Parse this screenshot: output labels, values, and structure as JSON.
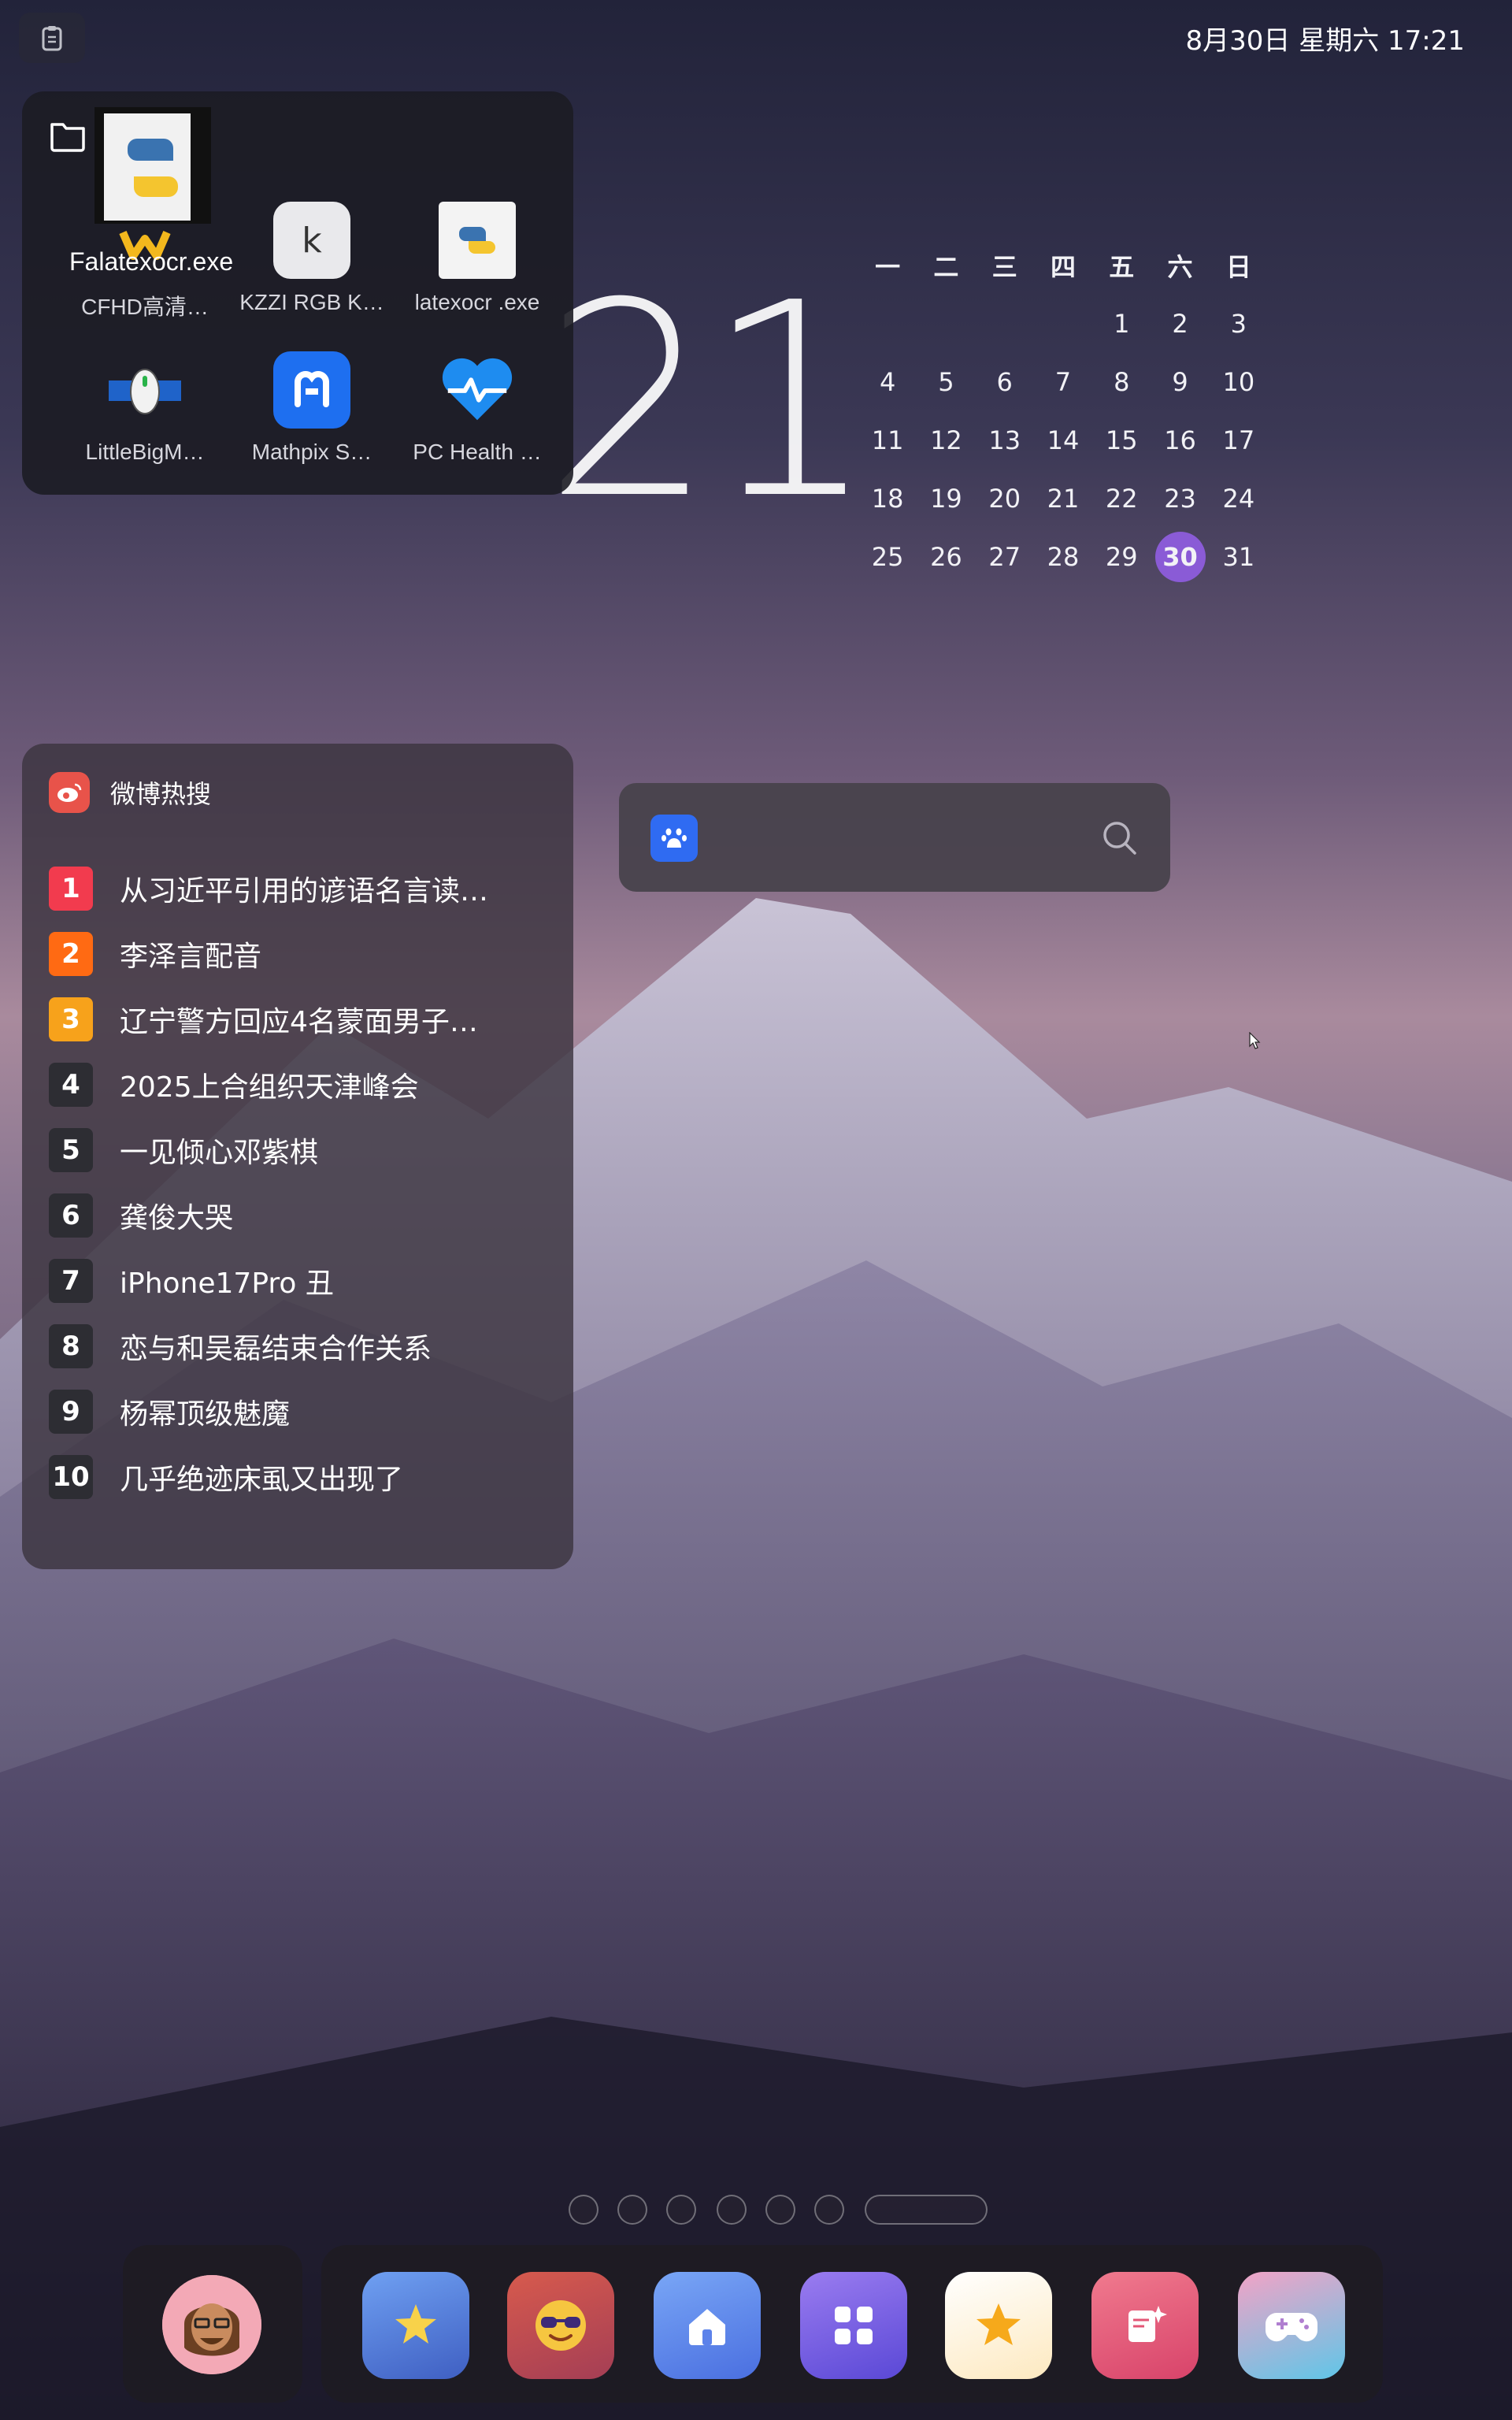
{
  "topbar": {
    "datetime": "8月30日 星期六 17:21",
    "clipboard_icon": "clipboard-icon"
  },
  "folder": {
    "icon": "folder-icon",
    "drag_label": "Falatexocr.exe",
    "apps": [
      {
        "label": "CFHD高清…",
        "icon": "cfhd-icon"
      },
      {
        "label": "KZZI RGB K…",
        "icon": "keyboard-k-icon"
      },
      {
        "label": "latexocr .exe",
        "icon": "python-file-icon"
      },
      {
        "label": "LittleBigM…",
        "icon": "mouse-icon"
      },
      {
        "label": "Mathpix S…",
        "icon": "mathpix-icon"
      },
      {
        "label": "PC Health …",
        "icon": "heart-pulse-icon"
      }
    ]
  },
  "clock": {
    "partial": "21"
  },
  "calendar": {
    "weekdays": [
      "一",
      "二",
      "三",
      "四",
      "五",
      "六",
      "日"
    ],
    "weeks": [
      [
        "",
        "",
        "",
        "",
        "1",
        "2",
        "3"
      ],
      [
        "4",
        "5",
        "6",
        "7",
        "8",
        "9",
        "10"
      ],
      [
        "11",
        "12",
        "13",
        "14",
        "15",
        "16",
        "17"
      ],
      [
        "18",
        "19",
        "20",
        "21",
        "22",
        "23",
        "24"
      ],
      [
        "25",
        "26",
        "27",
        "28",
        "29",
        "30",
        "31"
      ]
    ],
    "today": "30",
    "today_color": "#8a5bd6"
  },
  "weibo": {
    "title": "微博热搜",
    "items": [
      {
        "rank": "1",
        "text": "从习近平引用的谚语名言读…",
        "color": "#f23b4e"
      },
      {
        "rank": "2",
        "text": "李泽言配音",
        "color": "#ff6a13"
      },
      {
        "rank": "3",
        "text": "辽宁警方回应4名蒙面男子…",
        "color": "#f7a21b"
      },
      {
        "rank": "4",
        "text": "2025上合组织天津峰会",
        "color": "#2d2d33"
      },
      {
        "rank": "5",
        "text": "一见倾心邓紫棋",
        "color": "#2d2d33"
      },
      {
        "rank": "6",
        "text": "龚俊大哭",
        "color": "#2d2d33"
      },
      {
        "rank": "7",
        "text": "iPhone17Pro 丑",
        "color": "#2d2d33"
      },
      {
        "rank": "8",
        "text": "恋与和吴磊结束合作关系",
        "color": "#2d2d33"
      },
      {
        "rank": "9",
        "text": "杨幂顶级魅魔",
        "color": "#2d2d33"
      },
      {
        "rank": "10",
        "text": "几乎绝迹床虱又出现了",
        "color": "#2d2d33"
      }
    ]
  },
  "search": {
    "placeholder": "",
    "logo": "baidu-paw-icon"
  },
  "pager": {
    "pages": 7,
    "active": 7
  },
  "dock": {
    "avatar": "memoji-avatar",
    "apps": [
      {
        "icon": "star-sparkle-icon",
        "color": "#5b86e0"
      },
      {
        "icon": "sunglasses-emoji-icon",
        "color": "#c9524f"
      },
      {
        "icon": "home-icon",
        "color": "#6a92f0"
      },
      {
        "icon": "grid-apps-icon",
        "color": "#7a64e6"
      },
      {
        "icon": "star-icon",
        "color": "#fff1d4"
      },
      {
        "icon": "edit-sparkle-icon",
        "color": "#e8607c"
      },
      {
        "icon": "gamepad-icon",
        "color": "#d58fb8"
      }
    ]
  }
}
